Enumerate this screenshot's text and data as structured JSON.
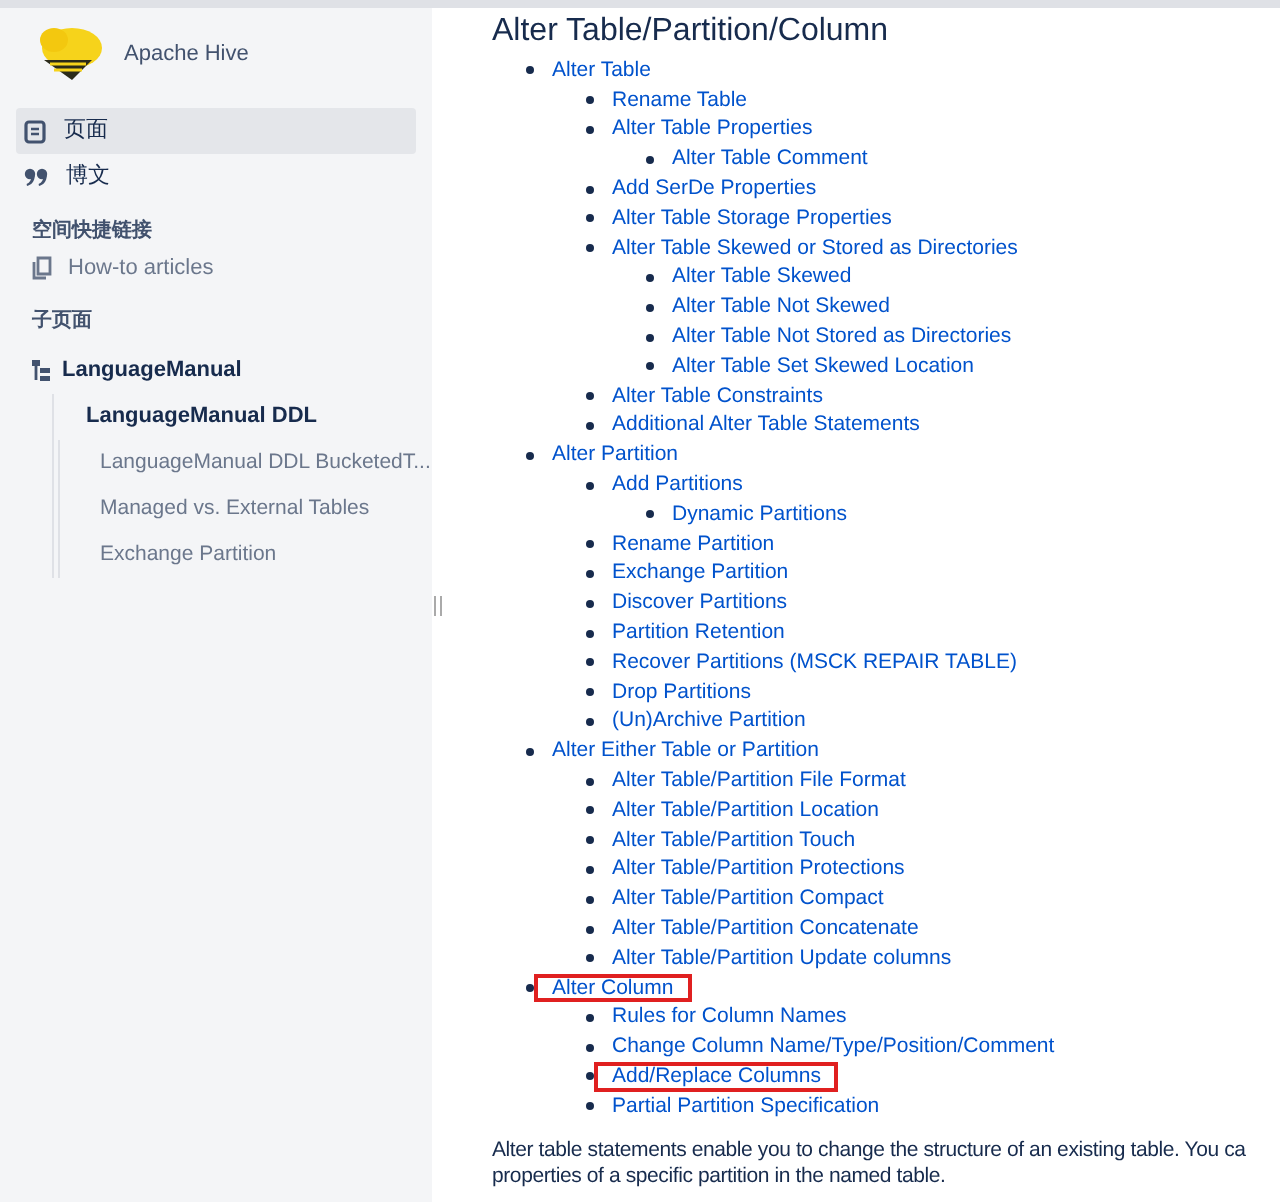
{
  "space": {
    "name": "Apache Hive"
  },
  "nav": [
    {
      "kind": "page",
      "label": "页面",
      "selected": true
    },
    {
      "kind": "blog",
      "label": "博文",
      "selected": false
    }
  ],
  "shortcuts": {
    "heading": "空间快捷链接",
    "items": [
      {
        "label": "How-to articles"
      }
    ]
  },
  "child_pages": {
    "heading": "子页面",
    "tree": [
      {
        "label": "LanguageManual",
        "children": [
          {
            "label": "LanguageManual DDL",
            "children": [
              {
                "label": "LanguageManual DDL BucketedT..."
              },
              {
                "label": "Managed vs. External Tables"
              },
              {
                "label": "Exchange Partition"
              }
            ]
          }
        ]
      }
    ]
  },
  "content": {
    "heading": "Alter Table/Partition/Column",
    "toc": [
      {
        "label": "Alter Table",
        "highlighted": false,
        "children": [
          {
            "label": "Rename Table",
            "highlighted": false
          },
          {
            "label": "Alter Table Properties",
            "highlighted": false,
            "children": [
              {
                "label": "Alter Table Comment",
                "highlighted": false
              }
            ]
          },
          {
            "label": "Add SerDe Properties",
            "highlighted": false
          },
          {
            "label": "Alter Table Storage Properties",
            "highlighted": false
          },
          {
            "label": "Alter Table Skewed or Stored as Directories",
            "highlighted": false,
            "children": [
              {
                "label": "Alter Table Skewed",
                "highlighted": false
              },
              {
                "label": "Alter Table Not Skewed",
                "highlighted": false
              },
              {
                "label": "Alter Table Not Stored as Directories",
                "highlighted": false
              },
              {
                "label": "Alter Table Set Skewed Location",
                "highlighted": false
              }
            ]
          },
          {
            "label": "Alter Table Constraints",
            "highlighted": false
          },
          {
            "label": "Additional Alter Table Statements",
            "highlighted": false
          }
        ]
      },
      {
        "label": "Alter Partition",
        "highlighted": false,
        "children": [
          {
            "label": "Add Partitions",
            "highlighted": false,
            "children": [
              {
                "label": "Dynamic Partitions",
                "highlighted": false
              }
            ]
          },
          {
            "label": "Rename Partition",
            "highlighted": false
          },
          {
            "label": "Exchange Partition",
            "highlighted": false
          },
          {
            "label": "Discover Partitions",
            "highlighted": false
          },
          {
            "label": "Partition Retention",
            "highlighted": false
          },
          {
            "label": "Recover Partitions (MSCK REPAIR TABLE)",
            "highlighted": false
          },
          {
            "label": "Drop Partitions",
            "highlighted": false
          },
          {
            "label": "(Un)Archive Partition",
            "highlighted": false
          }
        ]
      },
      {
        "label": "Alter Either Table or Partition",
        "highlighted": false,
        "children": [
          {
            "label": "Alter Table/Partition File Format",
            "highlighted": false
          },
          {
            "label": "Alter Table/Partition Location",
            "highlighted": false
          },
          {
            "label": "Alter Table/Partition Touch",
            "highlighted": false
          },
          {
            "label": "Alter Table/Partition Protections",
            "highlighted": false
          },
          {
            "label": "Alter Table/Partition Compact",
            "highlighted": false
          },
          {
            "label": "Alter Table/Partition Concatenate",
            "highlighted": false
          },
          {
            "label": "Alter Table/Partition Update columns",
            "highlighted": false
          }
        ]
      },
      {
        "label": "Alter Column",
        "highlighted": true,
        "children": [
          {
            "label": "Rules for Column Names",
            "highlighted": false
          },
          {
            "label": "Change Column Name/Type/Position/Comment",
            "highlighted": false
          },
          {
            "label": "Add/Replace Columns",
            "highlighted": true
          },
          {
            "label": "Partial Partition Specification",
            "highlighted": false
          }
        ]
      }
    ],
    "paragraph": [
      "Alter table statements enable you to change the structure of an existing table. You ca",
      "properties of a specific partition in the named table."
    ]
  }
}
